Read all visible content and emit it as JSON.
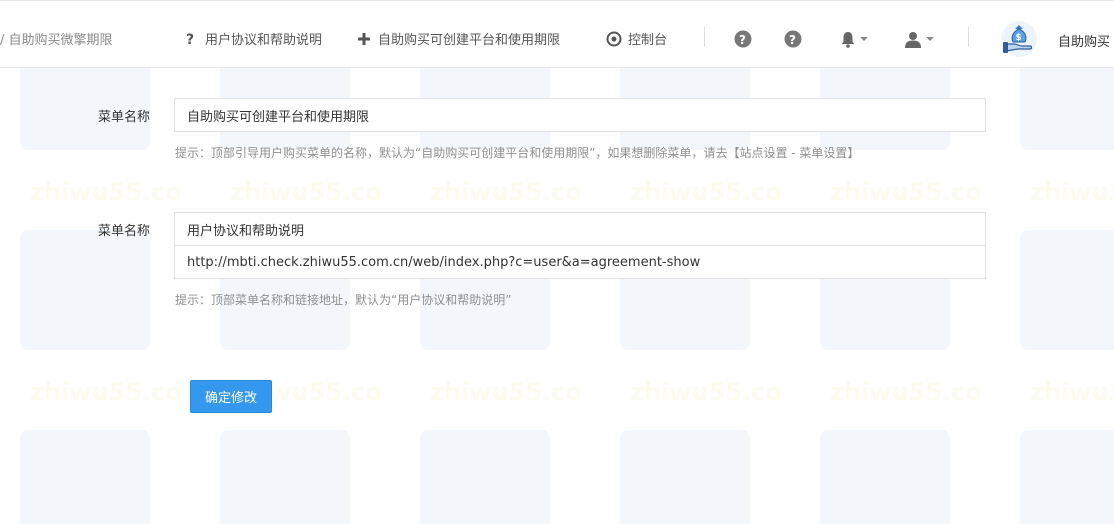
{
  "header": {
    "breadcrumb_text": "/ 自助购买微擎期限",
    "nav": {
      "agreement_label": "用户协议和帮助说明",
      "buy_label": "自助购买可创建平台和使用期限",
      "console_label": "控制台"
    },
    "brand_text": "自助购买"
  },
  "form": {
    "menu1": {
      "label": "菜单名称",
      "value": "自助购买可创建平台和使用期限",
      "hint": "提示：顶部引导用户购买菜单的名称，默认为“自助购买可创建平台和使用期限”，如果想删除菜单，请去【站点设置 - 菜单设置】"
    },
    "menu2": {
      "label": "菜单名称",
      "name_value": "用户协议和帮助说明",
      "url_value": "http://mbti.check.zhiwu55.com.cn/web/index.php?c=user&a=agreement-show",
      "hint": "提示：顶部菜单名称和链接地址，默认为“用户协议和帮助说明”"
    },
    "submit_label": "确定修改"
  },
  "colors": {
    "primary": "#3498ee",
    "border": "#e1e1e1",
    "hint": "#8f8f8f"
  }
}
